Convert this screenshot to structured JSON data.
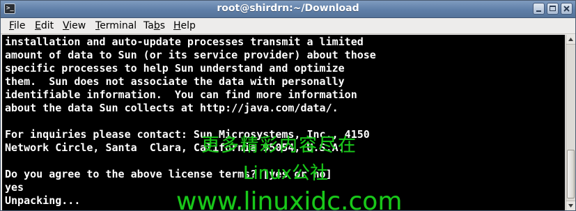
{
  "window": {
    "title": "root@shirdrn:~/Download",
    "icon": "terminal-icon"
  },
  "menubar": {
    "items": [
      {
        "pre": "",
        "mnemonic": "F",
        "post": "ile"
      },
      {
        "pre": "",
        "mnemonic": "E",
        "post": "dit"
      },
      {
        "pre": "",
        "mnemonic": "V",
        "post": "iew"
      },
      {
        "pre": "",
        "mnemonic": "T",
        "post": "erminal"
      },
      {
        "pre": "Ta",
        "mnemonic": "b",
        "post": "s"
      },
      {
        "pre": "",
        "mnemonic": "H",
        "post": "elp"
      }
    ]
  },
  "terminal": {
    "lines": [
      "installation and auto-update processes transmit a limited",
      "amount of data to Sun (or its service provider) about those",
      "specific processes to help Sun understand and optimize",
      "them.  Sun does not associate the data with personally",
      "identifiable information.  You can find more information",
      "about the data Sun collects at http://java.com/data/.",
      "",
      "For inquiries please contact: Sun Microsystems, Inc., 4150",
      "Network Circle, Santa  Clara, California 95054, U.S.A.",
      "",
      "Do you agree to the above license terms? [yes or no]",
      "yes",
      "Unpacking..."
    ]
  },
  "watermark": {
    "line1": "更多精彩内容尽在",
    "line2": "Linux公社",
    "line3": "www.linuxidc.com",
    "color": "#19c81a"
  }
}
